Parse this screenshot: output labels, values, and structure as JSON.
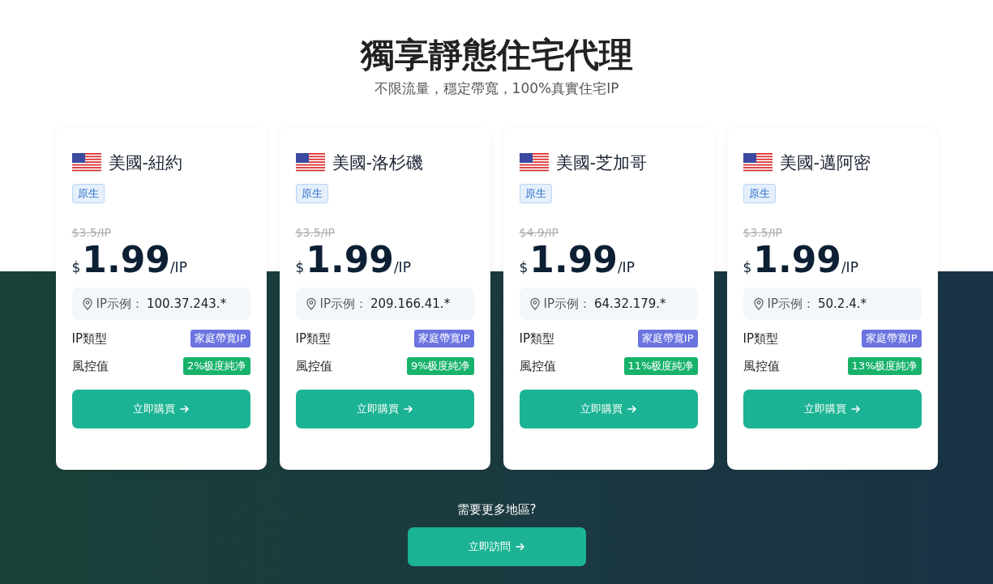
{
  "header": {
    "title": "獨享靜態住宅代理",
    "subtitle": "不限流量，穩定帶寬，100%真實住宅IP"
  },
  "cards": [
    {
      "location": "美國-紐約",
      "tag": "原生",
      "old_price": "$3.5/IP",
      "currency": "$",
      "price": "1.99",
      "unit": "/IP",
      "ip_label": "IP示例：",
      "ip_value": "100.37.243.*",
      "rows": [
        {
          "label": "IP類型",
          "value": "家庭帶寬IP",
          "kind": "type"
        },
        {
          "label": "風控值",
          "value": "2%极度純净",
          "kind": "risk"
        }
      ],
      "button": "立即購買"
    },
    {
      "location": "美國-洛杉磯",
      "tag": "原生",
      "old_price": "$3.5/IP",
      "currency": "$",
      "price": "1.99",
      "unit": "/IP",
      "ip_label": "IP示例：",
      "ip_value": "209.166.41.*",
      "rows": [
        {
          "label": "IP類型",
          "value": "家庭帶寬IP",
          "kind": "type"
        },
        {
          "label": "風控值",
          "value": "9%极度純净",
          "kind": "risk"
        }
      ],
      "button": "立即購買"
    },
    {
      "location": "美國-芝加哥",
      "tag": "原生",
      "old_price": "$4.9/IP",
      "currency": "$",
      "price": "1.99",
      "unit": "/IP",
      "ip_label": "IP示例：",
      "ip_value": "64.32.179.*",
      "rows": [
        {
          "label": "IP類型",
          "value": "家庭帶寬IP",
          "kind": "type"
        },
        {
          "label": "風控值",
          "value": "11%极度純净",
          "kind": "risk"
        }
      ],
      "button": "立即購買"
    },
    {
      "location": "美國-邁阿密",
      "tag": "原生",
      "old_price": "$3.5/IP",
      "currency": "$",
      "price": "1.99",
      "unit": "/IP",
      "ip_label": "IP示例：",
      "ip_value": "50.2.4.*",
      "rows": [
        {
          "label": "IP類型",
          "value": "家庭帶寬IP",
          "kind": "type"
        },
        {
          "label": "風控值",
          "value": "13%极度純净",
          "kind": "risk"
        }
      ],
      "button": "立即購買"
    }
  ],
  "footer": {
    "question": "需要更多地區?",
    "button": "立即訪問"
  }
}
